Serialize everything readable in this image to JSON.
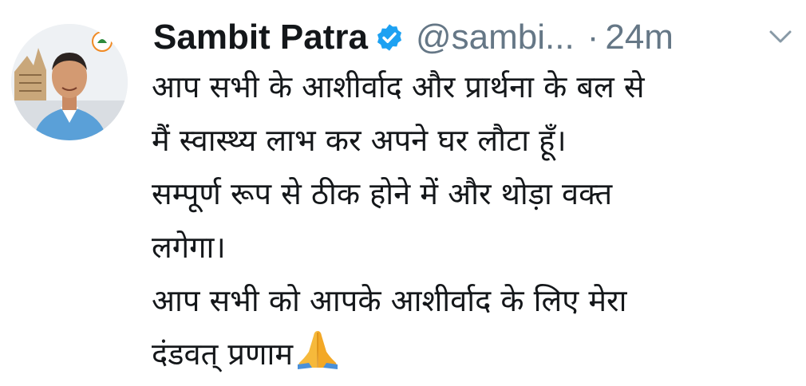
{
  "tweet": {
    "author": {
      "display_name": "Sambit Patra",
      "handle": "@sambi...",
      "verified": true,
      "avatar_icon": "profile-photo"
    },
    "separator": "·",
    "time": "24m",
    "menu_icon": "chevron-down-icon",
    "text_lines": [
      "आप सभी के आशीर्वाद और प्रार्थना के बल से",
      "मैं स्वास्थ्य लाभ कर अपने घर लौटा हूँ।",
      "सम्पूर्ण रूप से ठीक होने में और थोड़ा वक्त",
      "लगेगा।",
      "आप सभी को आपके आशीर्वाद के लिए मेरा",
      "दंडवत् प्रणाम"
    ],
    "trailing_emoji": "folded-hands-emoji",
    "colors": {
      "name": "#14171a",
      "meta": "#657786",
      "verified": "#1da1f2",
      "emoji": "#f6b93b"
    }
  }
}
